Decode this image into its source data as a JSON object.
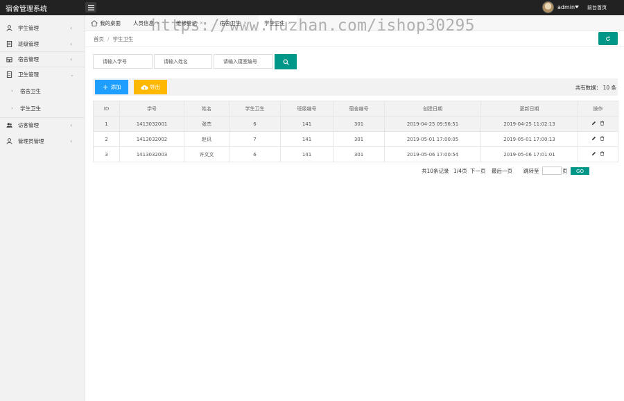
{
  "header": {
    "app_title": "宿舍管理系统",
    "user_name": "admin",
    "front_link": "前台首页"
  },
  "sidebar": {
    "items": [
      {
        "label": "学生管理",
        "icon": "user-icon"
      },
      {
        "label": "班级管理",
        "icon": "document-icon"
      },
      {
        "label": "宿舍管理",
        "icon": "building-icon"
      },
      {
        "label": "卫生管理",
        "icon": "document-icon",
        "expanded": true
      },
      {
        "label": "宿舍卫生",
        "sub": true
      },
      {
        "label": "学生卫生",
        "sub": true,
        "active": true
      },
      {
        "label": "访客管理",
        "icon": "users-icon"
      },
      {
        "label": "管理员管理",
        "icon": "user-icon"
      }
    ]
  },
  "tabs": [
    {
      "label": "我的桌面"
    },
    {
      "label": "人员信息"
    },
    {
      "label": "维修登记"
    },
    {
      "label": "宿舍卫生"
    },
    {
      "label": "学生卫生",
      "active": true
    }
  ],
  "breadcrumb": {
    "home": "首页",
    "current": "学生卫生"
  },
  "search": {
    "student_no_placeholder": "请输入学号",
    "name_placeholder": "请输入姓名",
    "dorm_no_placeholder": "请输入寝室编号"
  },
  "toolbar": {
    "add_label": "添加",
    "export_label": "导出",
    "total_text": "共有数据： 10 条"
  },
  "table": {
    "headers": [
      "ID",
      "学号",
      "姓名",
      "学生卫生",
      "班级编号",
      "宿舍编号",
      "创建日期",
      "更新日期",
      "操作"
    ],
    "rows": [
      [
        "1",
        "1413032001",
        "张杰",
        "6",
        "141",
        "301",
        "2019-04-25 09:56:51",
        "2019-04-25 11:02:13"
      ],
      [
        "2",
        "1413032002",
        "赵讯",
        "7",
        "141",
        "301",
        "2019-05-01 17:00:05",
        "2019-05-01 17:00:13"
      ],
      [
        "3",
        "1413032003",
        "许文文",
        "6",
        "141",
        "301",
        "2019-05-06 17:00:54",
        "2019-05-06 17:01:01"
      ]
    ]
  },
  "pagination": {
    "summary": "共10条记录",
    "page": "1/4页",
    "next": "下一页",
    "last": "最后一页",
    "jump_label": "跳转至",
    "page_unit": "页",
    "go": "GO"
  },
  "watermark": "https://www.huzhan.com/ishop30295",
  "colors": {
    "primary": "#009688",
    "add": "#1e9fff",
    "export": "#ffb800",
    "header_bg": "#222222"
  }
}
